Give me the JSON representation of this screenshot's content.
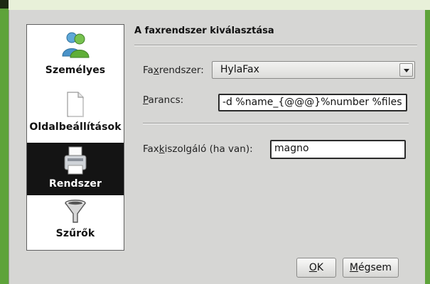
{
  "sidebar": {
    "items": [
      {
        "label": "Személyes",
        "icon": "users-icon"
      },
      {
        "label": "Oldalbeállítások",
        "icon": "document-icon"
      },
      {
        "label": "Rendszer",
        "icon": "fax-icon",
        "selected": true
      },
      {
        "label": "Szűrők",
        "icon": "funnel-icon"
      }
    ]
  },
  "main": {
    "title": "A faxrendszer kiválasztása",
    "fax_system": {
      "label_pre": "Fa",
      "label_u": "x",
      "label_post": "rendszer:",
      "value": "HylaFax"
    },
    "command": {
      "label_u": "P",
      "label_post": "arancs:",
      "value": "-d %name_{@@@}%number %files"
    },
    "server": {
      "label_pre": "Fax",
      "label_u": "k",
      "label_post": "iszolgáló (ha van):",
      "value": "magno"
    }
  },
  "buttons": {
    "ok": {
      "u": "O",
      "rest": "K"
    },
    "cancel": {
      "u": "M",
      "rest": "égsem"
    }
  },
  "colors": {
    "desktop": "#5ea33a",
    "selected": "#141414"
  }
}
